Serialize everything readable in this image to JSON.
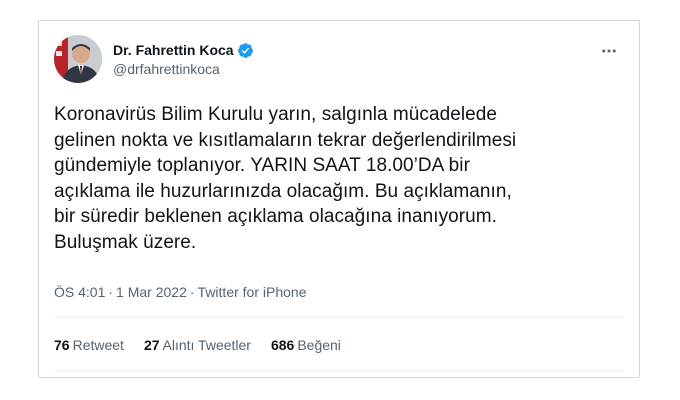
{
  "tweet": {
    "author": {
      "display_name": "Dr. Fahrettin Koca",
      "handle": "@drfahrettinkoca",
      "verified": true,
      "verified_color": "#1d9bf0"
    },
    "text": "Koronavirüs Bilim Kurulu yarın, salgınla mücadelede\ngelinen nokta ve kısıtlamaların tekrar değerlendirilmesi\ngündemiyle toplanıyor. YARIN SAAT 18.00’DA bir\naçıklama ile huzurlarınızda olacağım. Bu açıklamanın,\nbir süredir beklenen açıklama olacağına inanıyorum.\nBuluşmak üzere.",
    "meta": {
      "time": "ÖS 4:01",
      "separator": "·",
      "date": "1 Mar 2022",
      "source": "Twitter for iPhone"
    },
    "stats": {
      "retweets": {
        "count": "76",
        "label": "Retweet"
      },
      "quotes": {
        "count": "27",
        "label": "Alıntı Tweetler"
      },
      "likes": {
        "count": "686",
        "label": "Beğeni"
      }
    },
    "more_icon": "more-horizontal-icon"
  }
}
